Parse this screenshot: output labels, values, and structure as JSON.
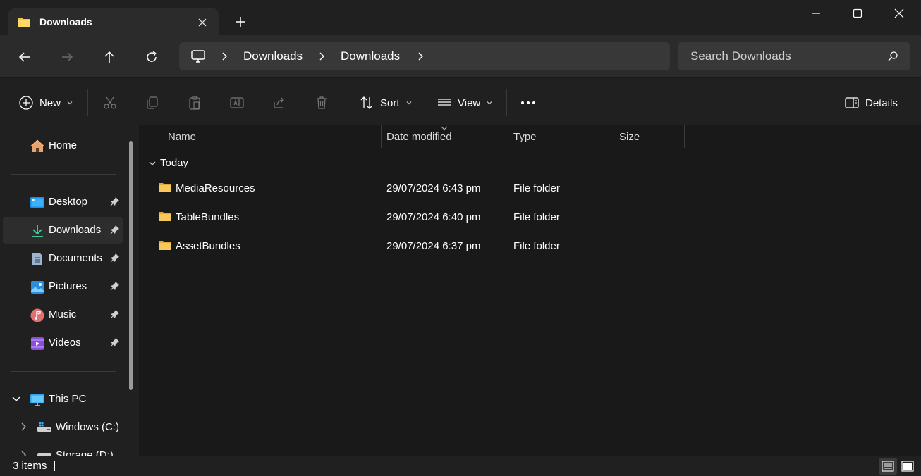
{
  "tab": {
    "title": "Downloads"
  },
  "address": {
    "crumbs": [
      "Downloads",
      "Downloads"
    ]
  },
  "search": {
    "placeholder": "Search Downloads"
  },
  "commands": {
    "new_label": "New",
    "sort_label": "Sort",
    "view_label": "View",
    "details_label": "Details"
  },
  "sidebar": {
    "home": "Home",
    "quick": [
      {
        "label": "Desktop",
        "icon": "desktop-icon"
      },
      {
        "label": "Downloads",
        "icon": "download-icon"
      },
      {
        "label": "Documents",
        "icon": "document-icon"
      },
      {
        "label": "Pictures",
        "icon": "pictures-icon"
      },
      {
        "label": "Music",
        "icon": "music-icon"
      },
      {
        "label": "Videos",
        "icon": "videos-icon"
      }
    ],
    "this_pc": "This PC",
    "drives": [
      "Windows (C:)",
      "Storage (D:)"
    ]
  },
  "columns": {
    "name": "Name",
    "date": "Date modified",
    "type": "Type",
    "size": "Size"
  },
  "group": {
    "label": "Today"
  },
  "files": [
    {
      "name": "MediaResources",
      "date": "29/07/2024 6:43 pm",
      "type": "File folder"
    },
    {
      "name": "TableBundles",
      "date": "29/07/2024 6:40 pm",
      "type": "File folder"
    },
    {
      "name": "AssetBundles",
      "date": "29/07/2024 6:37 pm",
      "type": "File folder"
    }
  ],
  "status": {
    "count": "3 items"
  },
  "colors": {
    "folder": "#f2c14e",
    "accent": "#4cc2ff",
    "background": "#191919"
  }
}
